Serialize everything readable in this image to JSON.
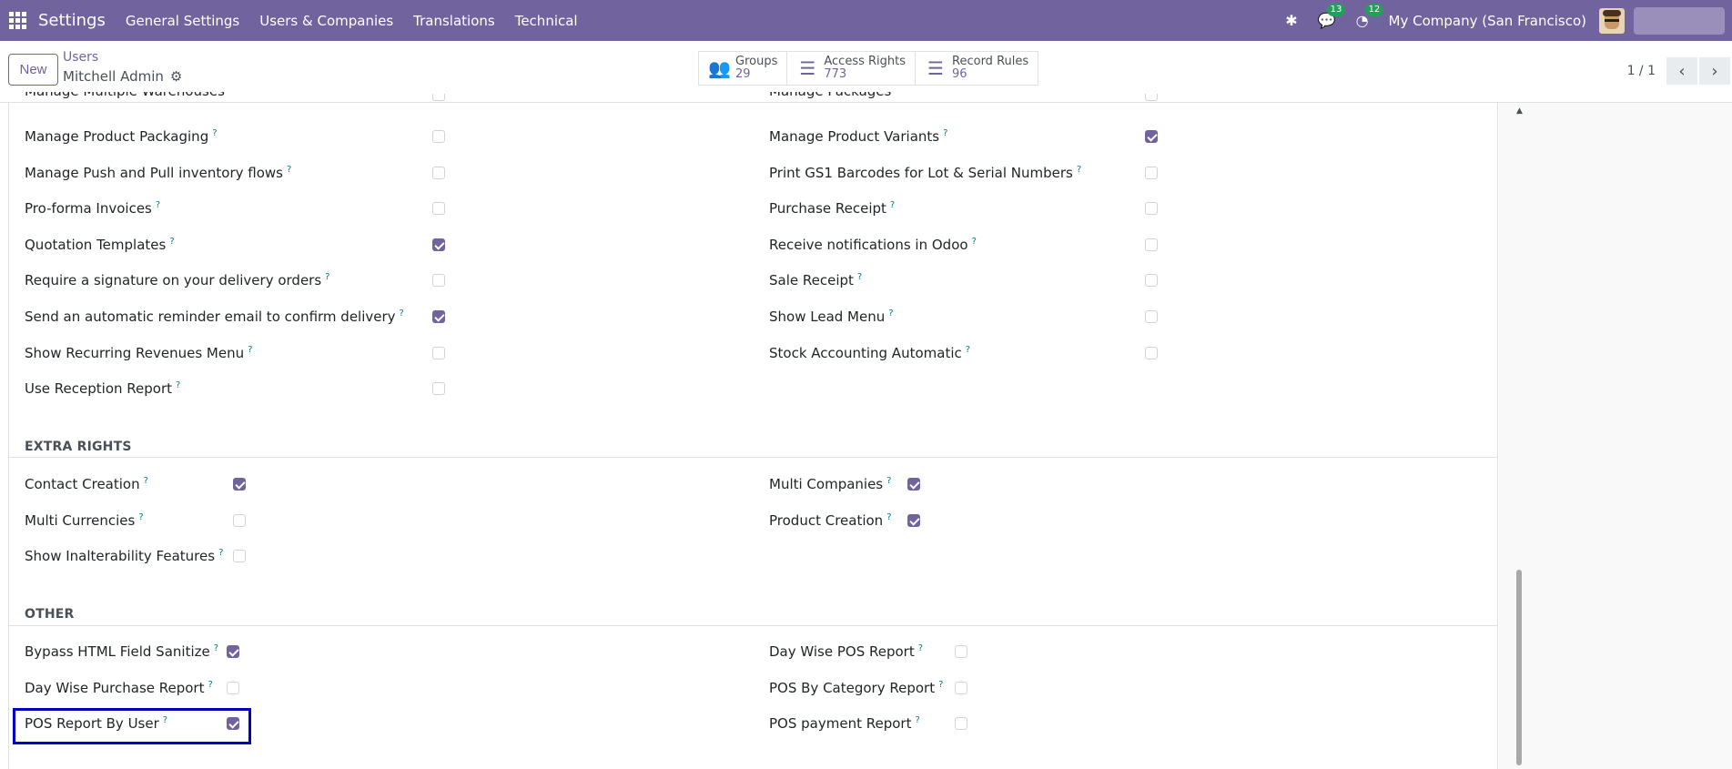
{
  "navbar": {
    "app_name": "Settings",
    "menu": [
      "General Settings",
      "Users & Companies",
      "Translations",
      "Technical"
    ],
    "messages_count": "13",
    "activities_count": "12",
    "company": "My Company (San Francisco)"
  },
  "control": {
    "new_label": "New",
    "breadcrumb": "Users",
    "record_title": "Mitchell Admin",
    "stats": [
      {
        "label": "Groups",
        "value": "29"
      },
      {
        "label": "Access Rights",
        "value": "773"
      },
      {
        "label": "Record Rules",
        "value": "96"
      }
    ],
    "pager": "1 / 1"
  },
  "top_partial": {
    "left": "Manage Multiple Warehouses",
    "right": "Manage Packages"
  },
  "inventory_rows_left": [
    {
      "label": "Manage Product Packaging",
      "checked": false
    },
    {
      "label": "Manage Push and Pull inventory flows",
      "checked": false
    },
    {
      "label": "Pro-forma Invoices",
      "checked": false
    },
    {
      "label": "Quotation Templates",
      "checked": true
    },
    {
      "label": "Require a signature on your delivery orders",
      "checked": false
    },
    {
      "label": "Send an automatic reminder email to confirm delivery",
      "checked": true
    },
    {
      "label": "Show Recurring Revenues Menu",
      "checked": false
    },
    {
      "label": "Use Reception Report",
      "checked": false
    }
  ],
  "inventory_rows_right": [
    {
      "label": "Manage Product Variants",
      "checked": true
    },
    {
      "label": "Print GS1 Barcodes for Lot & Serial Numbers",
      "checked": false
    },
    {
      "label": "Purchase Receipt",
      "checked": false
    },
    {
      "label": "Receive notifications in Odoo",
      "checked": false
    },
    {
      "label": "Sale Receipt",
      "checked": false
    },
    {
      "label": "Show Lead Menu",
      "checked": false
    },
    {
      "label": "Stock Accounting Automatic",
      "checked": false
    }
  ],
  "extra_rights": {
    "title": "EXTRA RIGHTS",
    "left": [
      {
        "label": "Contact Creation",
        "checked": true
      },
      {
        "label": "Multi Currencies",
        "checked": false
      },
      {
        "label": "Show Inalterability Features",
        "checked": false
      }
    ],
    "right": [
      {
        "label": "Multi Companies",
        "checked": true
      },
      {
        "label": "Product Creation",
        "checked": true
      }
    ]
  },
  "other": {
    "title": "OTHER",
    "left": [
      {
        "label": "Bypass HTML Field Sanitize",
        "checked": true
      },
      {
        "label": "Day Wise Purchase Report",
        "checked": false
      },
      {
        "label": "POS Report By User",
        "checked": true
      }
    ],
    "right": [
      {
        "label": "Day Wise POS Report",
        "checked": false
      },
      {
        "label": "POS By Category Report",
        "checked": false
      },
      {
        "label": "POS payment Report",
        "checked": false
      }
    ]
  },
  "help_mark": "?"
}
